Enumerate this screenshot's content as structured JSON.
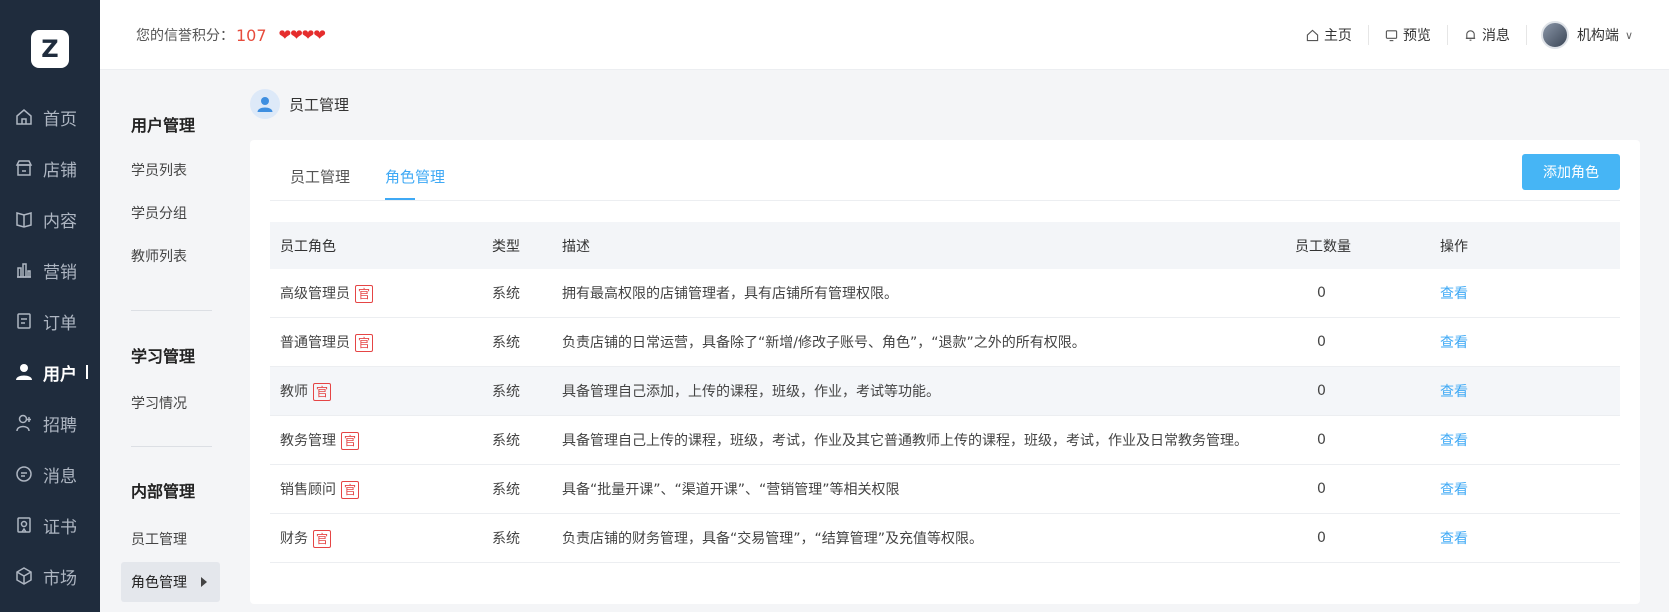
{
  "logo": {
    "letter": "Z"
  },
  "leftnav": [
    {
      "label": "首页",
      "icon": "home-icon"
    },
    {
      "label": "店铺",
      "icon": "store-icon"
    },
    {
      "label": "内容",
      "icon": "book-icon"
    },
    {
      "label": "营销",
      "icon": "bar-chart-icon"
    },
    {
      "label": "订单",
      "icon": "order-icon"
    },
    {
      "label": "用户",
      "icon": "user-icon"
    },
    {
      "label": "招聘",
      "icon": "recruit-icon"
    },
    {
      "label": "消息",
      "icon": "message-icon"
    },
    {
      "label": "证书",
      "icon": "certificate-icon"
    },
    {
      "label": "市场",
      "icon": "market-icon"
    }
  ],
  "header": {
    "credit_label": "您的信誉积分：",
    "credit_score": "107",
    "hearts": "❤❤❤❤",
    "links": [
      "主页",
      "预览",
      "消息"
    ],
    "account": "机构端"
  },
  "subnav": {
    "group1_title": "用户管理",
    "group1_items": [
      "学员列表",
      "学员分组",
      "教师列表"
    ],
    "group2_title": "学习管理",
    "group2_items": [
      "学习情况"
    ],
    "group3_title": "内部管理",
    "group3_items": [
      "员工管理",
      "角色管理"
    ]
  },
  "page": {
    "title": "员工管理"
  },
  "tabs": [
    "员工管理",
    "角色管理"
  ],
  "add_button": "添加角色",
  "table": {
    "headers": [
      "员工角色",
      "类型",
      "描述",
      "员工数量",
      "操作"
    ],
    "tag": "官",
    "rows": [
      {
        "role": "高级管理员",
        "type": "系统",
        "desc": "拥有最高权限的店铺管理者，具有店铺所有管理权限。",
        "count": "0",
        "action": "查看"
      },
      {
        "role": "普通管理员",
        "type": "系统",
        "desc": "负责店铺的日常运营，具备除了“新增/修改子账号、角色”，“退款”之外的所有权限。",
        "count": "0",
        "action": "查看"
      },
      {
        "role": "教师",
        "type": "系统",
        "desc": "具备管理自己添加，上传的课程，班级，作业，考试等功能。",
        "count": "0",
        "action": "查看"
      },
      {
        "role": "教务管理",
        "type": "系统",
        "desc": "具备管理自己上传的课程，班级，考试，作业及其它普通教师上传的课程，班级，考试，作业及日常教务管理。",
        "count": "0",
        "action": "查看"
      },
      {
        "role": "销售顾问",
        "type": "系统",
        "desc": "具备“批量开课”、“渠道开课”、“营销管理”等相关权限",
        "count": "0",
        "action": "查看"
      },
      {
        "role": "财务",
        "type": "系统",
        "desc": "负责店铺的财务管理，具备“交易管理”，“结算管理”及充值等权限。",
        "count": "0",
        "action": "查看"
      }
    ]
  }
}
